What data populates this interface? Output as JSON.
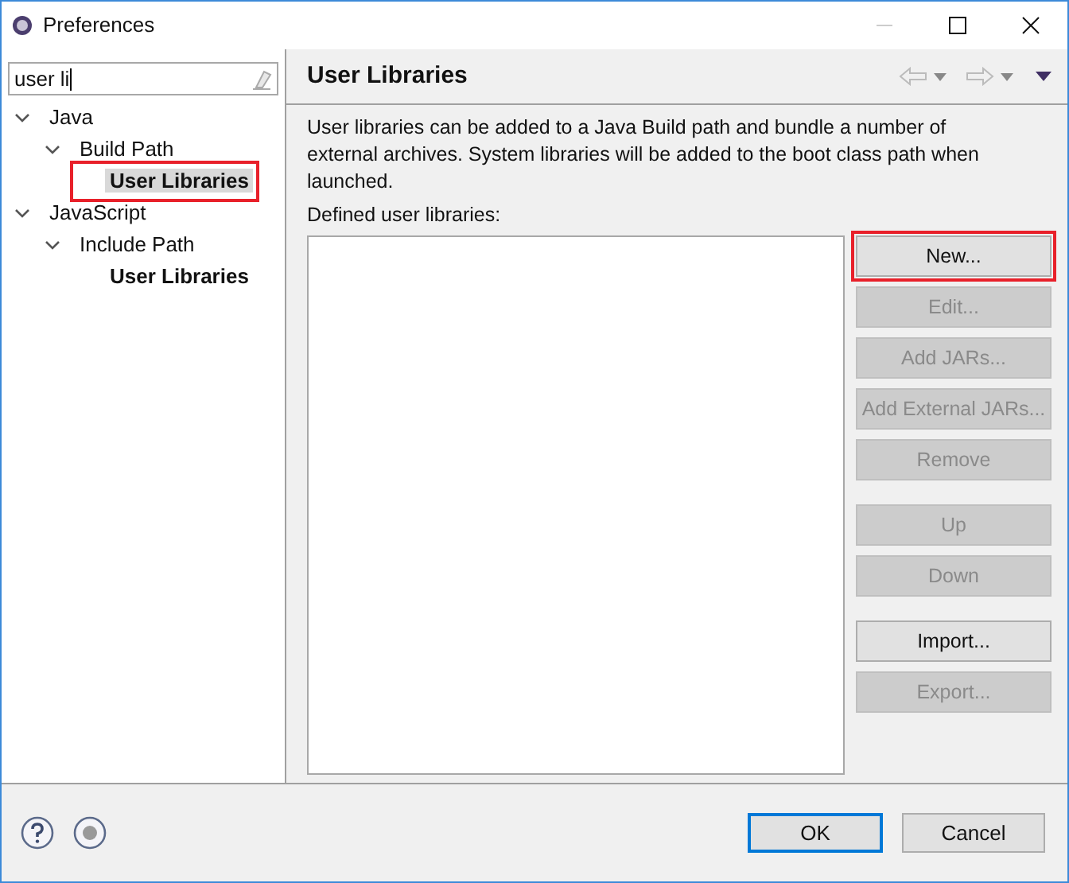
{
  "window": {
    "title": "Preferences"
  },
  "filter": {
    "value": "user li"
  },
  "tree": [
    {
      "label": "Java",
      "expanded": true,
      "bold": false,
      "selected": false,
      "highlighted": false,
      "children": [
        {
          "label": "Build Path",
          "expanded": true,
          "bold": false,
          "selected": false,
          "highlighted": false,
          "children": [
            {
              "label": "User Libraries",
              "bold": true,
              "selected": true,
              "highlighted": true
            }
          ]
        }
      ]
    },
    {
      "label": "JavaScript",
      "expanded": true,
      "bold": false,
      "selected": false,
      "highlighted": false,
      "children": [
        {
          "label": "Include Path",
          "expanded": true,
          "bold": false,
          "selected": false,
          "highlighted": false,
          "children": [
            {
              "label": "User Libraries",
              "bold": true,
              "selected": false,
              "highlighted": false
            }
          ]
        }
      ]
    }
  ],
  "page": {
    "title": "User Libraries",
    "description": "User libraries can be added to a Java Build path and bundle a number of external archives. System libraries will be added to the boot class path when launched.",
    "list_label": "Defined user libraries:",
    "button_groups": [
      [
        {
          "label": "New...",
          "disabled": false,
          "highlighted": true
        },
        {
          "label": "Edit...",
          "disabled": true,
          "highlighted": false
        },
        {
          "label": "Add JARs...",
          "disabled": true,
          "highlighted": false
        },
        {
          "label": "Add External JARs...",
          "disabled": true,
          "highlighted": false
        },
        {
          "label": "Remove",
          "disabled": true,
          "highlighted": false
        }
      ],
      [
        {
          "label": "Up",
          "disabled": true,
          "highlighted": false
        },
        {
          "label": "Down",
          "disabled": true,
          "highlighted": false
        }
      ],
      [
        {
          "label": "Import...",
          "disabled": false,
          "highlighted": false
        },
        {
          "label": "Export...",
          "disabled": true,
          "highlighted": false
        }
      ]
    ]
  },
  "buttons": [
    {
      "label": "OK",
      "default": true
    },
    {
      "label": "Cancel",
      "default": false
    }
  ]
}
